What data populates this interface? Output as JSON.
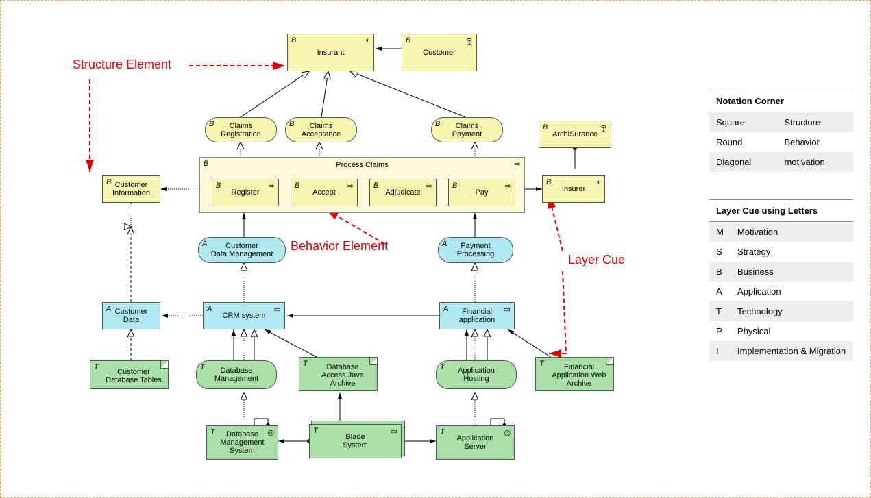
{
  "annotations": {
    "structure": "Structure Element",
    "behavior": "Behavior Element",
    "layer": "Layer Cue"
  },
  "nodes": {
    "insurant": "Insurant",
    "customer": "Customer",
    "claimsReg": "Claims\nRegistration",
    "claimsAcc": "Claims\nAcceptance",
    "claimsPay": "Claims\nPayment",
    "archisurance": "ArchiSurance",
    "processClaims": "Process Claims",
    "register": "Register",
    "accept": "Accept",
    "adjudicate": "Adjudicate",
    "pay": "Pay",
    "custInfo": "Customer\nInformation",
    "insurer": "Insurer",
    "custDataMgmt": "Customer\nData Management",
    "payProc": "Payment\nProcessing",
    "custData": "Customer\nData",
    "crm": "CRM system",
    "finApp": "Financial\napplication",
    "custDbTables": "Customer\nDatabase Tables",
    "dbMgmt": "Database\nManagement",
    "dbJava": "Database\nAccess Java\nArchive",
    "appHost": "Application\nHosting",
    "finWeb": "Financial\nApplication Web\nArchive",
    "dbms": "Database\nManagement\nSystem",
    "blade": "Blade\nSystem",
    "appServer": "Application\nServer"
  },
  "letters": {
    "B": "B",
    "A": "A",
    "T": "T"
  },
  "notation": {
    "title": "Notation Corner",
    "rows": [
      [
        "Square",
        "Structure"
      ],
      [
        "Round",
        "Behavior"
      ],
      [
        "Diagonal",
        "motivation"
      ]
    ]
  },
  "layers": {
    "title": "Layer Cue using Letters",
    "rows": [
      [
        "M",
        "Motivation"
      ],
      [
        "S",
        "Strategy"
      ],
      [
        "B",
        "Business"
      ],
      [
        "A",
        "Application"
      ],
      [
        "T",
        "Technology"
      ],
      [
        "P",
        "Physical"
      ],
      [
        "I",
        "Implementation & Migration"
      ]
    ]
  }
}
